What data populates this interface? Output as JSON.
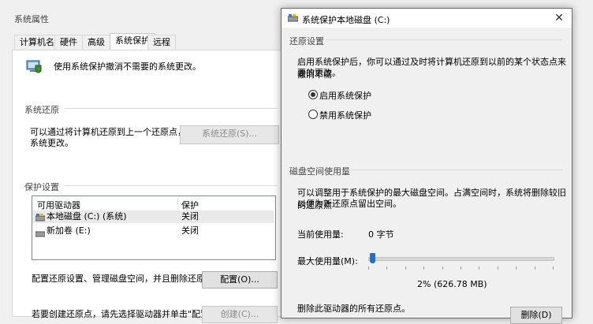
{
  "background_window": {
    "title": "系统属性",
    "tabs": [
      "计算机名",
      "硬件",
      "高级",
      "系统保护",
      "远程"
    ],
    "active_tab": "系统保护",
    "intro_text": "使用系统保护撤消不需要的系统更改。",
    "system_restore": {
      "heading": "系统还原",
      "description_line1": "可以通过将计算机还原到上一个还原点，撤消",
      "description_line2": "系统更改。",
      "button": "系统还原(S)..."
    },
    "protection_settings": {
      "heading": "保护设置",
      "columns": [
        "可用驱动器",
        "保护"
      ],
      "drives": [
        {
          "name": "本地磁盘 (C:) (系统)",
          "protection": "关闭"
        },
        {
          "name": "新加卷 (E:)",
          "protection": "关闭"
        }
      ],
      "configure_text": "配置还原设置、管理磁盘空间，并且删除还原点。",
      "configure_button": "配置(O)...",
      "create_text": "若要创建还原点，请先选择驱动器并单击\"配置\"来",
      "create_button": "创建(C)..."
    }
  },
  "dialog": {
    "title": "系统保护本地磁盘 (C:)",
    "restore_settings": {
      "heading": "还原设置",
      "description_line1": "启用系统保护后，你可以通过及时将计算机还原到以前的某个状态点来撤消不需",
      "description_line2": "要的更改。",
      "options": [
        "启用系统保护",
        "禁用系统保护"
      ],
      "selected_option": "启用系统保护"
    },
    "disk_space": {
      "heading": "磁盘空间使用量",
      "description_line1": "可以调整用于系统保护的最大磁盘空间。占满空间时，系统将删除较旧的还原点",
      "description_line2": "以便为新还原点留出空间。",
      "current_usage_label": "当前使用量:",
      "current_usage_value": "0 字节",
      "max_usage_label": "最大使用量(M):",
      "max_usage_fraction": 0.02,
      "max_usage_readout": "2% (626.78 MB)",
      "delete_text": "删除此驱动器的所有还原点。",
      "delete_button": "删除(D)"
    }
  },
  "colors": {
    "accent": "#1e6fd6",
    "panel": "#ffffff",
    "chrome": "#f0f0f0"
  },
  "icons": [
    "system-protection-icon",
    "drive-c-icon",
    "drive-e-icon",
    "dialog-drive-icon",
    "close-icon"
  ]
}
